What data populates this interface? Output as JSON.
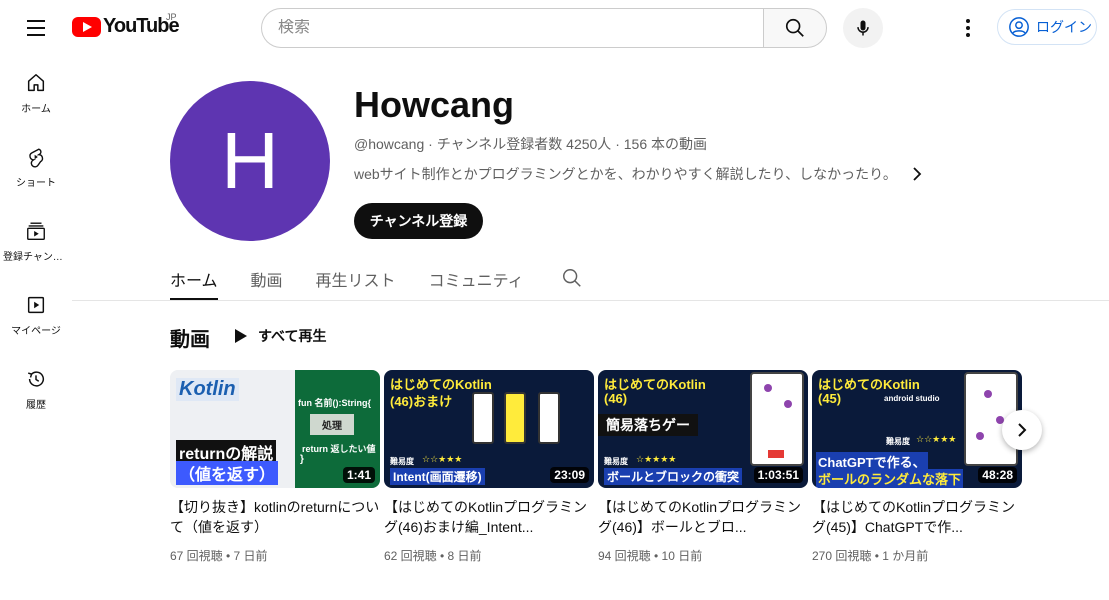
{
  "header": {
    "logo_text": "YouTube",
    "region": "JP",
    "search_placeholder": "検索",
    "login_label": "ログイン"
  },
  "sidebar": {
    "items": [
      {
        "label": "ホーム",
        "icon": "home-icon"
      },
      {
        "label": "ショート",
        "icon": "shorts-icon"
      },
      {
        "label": "登録チャンネル",
        "icon": "subscriptions-icon"
      },
      {
        "label": "マイページ",
        "icon": "library-icon"
      },
      {
        "label": "履歴",
        "icon": "history-icon"
      }
    ]
  },
  "channel": {
    "avatar_letter": "H",
    "avatar_color": "#5e35b1",
    "name": "Howcang",
    "meta": "@howcang · チャンネル登録者数 4250人 · 156 本の動画",
    "description": "webサイト制作とかプログラミングとかを、わかりやすく解説したり、しなかったり。",
    "subscribe_label": "チャンネル登録"
  },
  "tabs": [
    "ホーム",
    "動画",
    "再生リスト",
    "コミュニティ"
  ],
  "section": {
    "title": "動画",
    "play_all_label": "すべて再生"
  },
  "videos": [
    {
      "title": "【切り抜き】kotlinのreturnについて（値を返す）",
      "meta": "67 回視聴 • 7 日前",
      "duration": "1:41",
      "thumb_lines": [
        "Kotlin",
        "returnの解説",
        "（値を返す）",
        "fun 名前():String{",
        "処理",
        "return 返したい値",
        "}"
      ]
    },
    {
      "title": "【はじめてのKotlinプログラミング(46)おまけ編_Intent...",
      "meta": "62 回視聴 • 8 日前",
      "duration": "23:09",
      "thumb_lines": [
        "はじめてのKotlin",
        "(46)おまけ",
        "Intent(画面遷移)",
        "難易度",
        "☆☆★★★"
      ]
    },
    {
      "title": "【はじめてのKotlinプログラミング(46)】ボールとブロ...",
      "meta": "94 回視聴 • 10 日前",
      "duration": "1:03:51",
      "thumb_lines": [
        "はじめてのKotlin",
        "(46)",
        "簡易落ちゲー",
        "難易度",
        "☆★★★★",
        "ボールとブロックの衝突"
      ]
    },
    {
      "title": "【はじめてのKotlinプログラミング(45)】ChatGPTで作...",
      "meta": "270 回視聴 • 1 か月前",
      "duration": "48:28",
      "thumb_lines": [
        "はじめてのKotlin",
        "(45)",
        "android studio",
        "難易度",
        "☆☆★★★",
        "ChatGPTで作る、",
        "ボールのランダムな落下"
      ]
    }
  ]
}
